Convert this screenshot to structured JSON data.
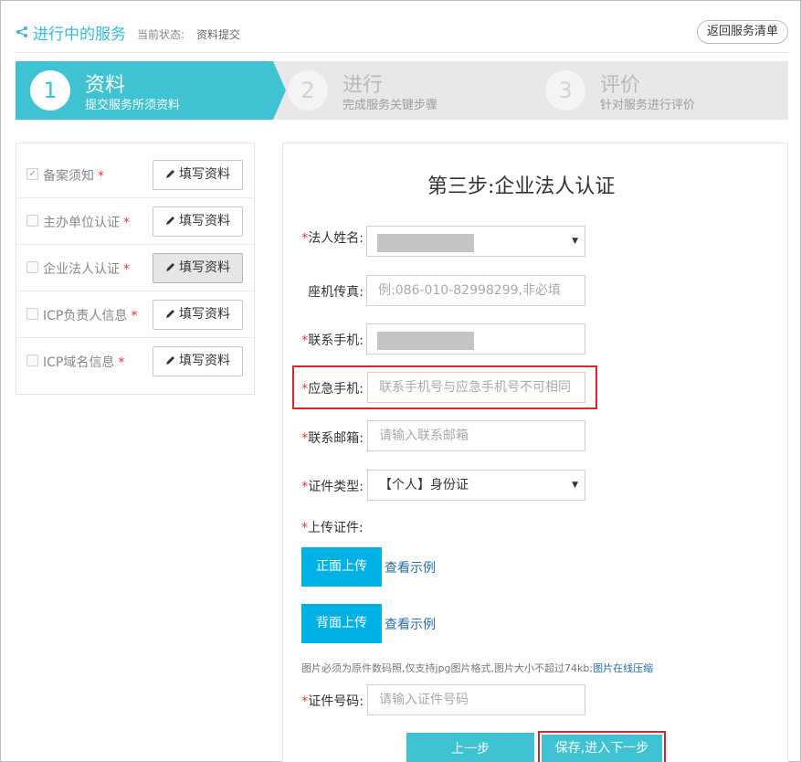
{
  "header": {
    "title": "进行中的服务",
    "status_label": "当前状态:",
    "status_value": "资料提交",
    "back_button": "返回服务清单"
  },
  "steps": [
    {
      "num": "1",
      "title": "资料",
      "sub": "提交服务所须资料",
      "active": true
    },
    {
      "num": "2",
      "title": "进行",
      "sub": "完成服务关键步骤",
      "active": false
    },
    {
      "num": "3",
      "title": "评价",
      "sub": "针对服务进行评价",
      "active": false
    }
  ],
  "sidebar": {
    "items": [
      {
        "label": "备案须知",
        "checked": true
      },
      {
        "label": "主办单位认证",
        "checked": false
      },
      {
        "label": "企业法人认证",
        "checked": false,
        "active": true
      },
      {
        "label": "ICP负责人信息",
        "checked": false
      },
      {
        "label": "ICP域名信息",
        "checked": false
      }
    ],
    "required_mark": "*",
    "fill_button": "填写资料"
  },
  "form": {
    "title": "第三步:企业法人认证",
    "legal_name_label": "法人姓名:",
    "landline_label": "座机传真:",
    "landline_placeholder": "例:086-010-82998299,非必填",
    "mobile_label": "联系手机:",
    "emergency_label": "应急手机:",
    "emergency_placeholder": "联系手机号与应急手机号不可相同",
    "email_label": "联系邮箱:",
    "email_placeholder": "请输入联系邮箱",
    "id_type_label": "证件类型:",
    "id_type_value": "【个人】身份证",
    "upload_label": "上传证件:",
    "front_upload": "正面上传",
    "back_upload": "背面上传",
    "view_example": "查看示例",
    "hint_text": "图片必须为原件数码照,仅支持jpg图片格式,图片大小不超过74kb;",
    "hint_link": "图片在线压缩",
    "id_number_label": "证件号码:",
    "id_number_placeholder": "请输入证件号码",
    "prev_button": "上一步",
    "next_button": "保存,进入下一步"
  },
  "colors": {
    "accent": "#3fc3d2",
    "upload": "#00b1e6",
    "required": "#e3393c",
    "highlight": "#d9262a"
  }
}
